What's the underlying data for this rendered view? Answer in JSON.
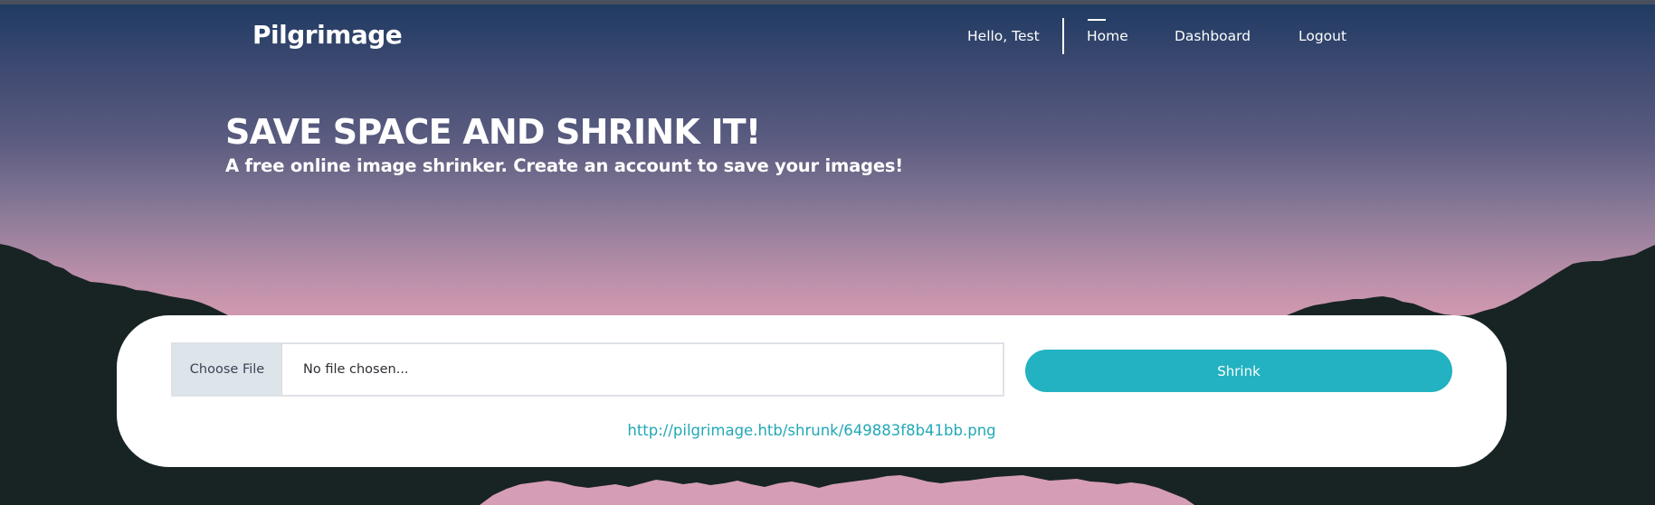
{
  "navbar": {
    "brand": "Pilgrimage",
    "greeting": "Hello, Test",
    "links": [
      "Home",
      "Dashboard",
      "Logout"
    ],
    "active": "Home"
  },
  "hero": {
    "title": "SAVE SPACE AND SHRINK IT!",
    "subtitle": "A free online image shrinker. Create an account to save your images!"
  },
  "upload": {
    "choose_label": "Choose File",
    "file_status": "No file chosen...",
    "submit_label": "Shrink",
    "result_url": "http://pilgrimage.htb/shrunk/649883f8b41bb.png"
  },
  "colors": {
    "accent": "#22b2c1",
    "link": "#22a8b6",
    "mountain": "#182424",
    "sky_top": "#1d3a61",
    "sky_bottom": "#cf98b0"
  }
}
